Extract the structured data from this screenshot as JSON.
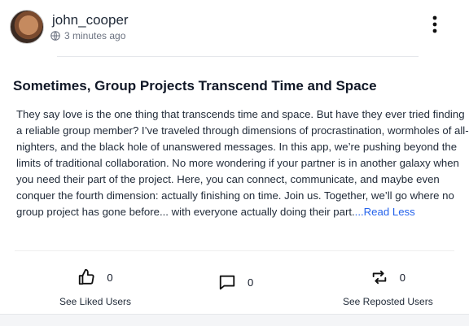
{
  "post": {
    "username": "john_cooper",
    "timestamp": "3 minutes ago",
    "title": "Sometimes, Group Projects Transcend Time and Space",
    "body": "They say love is the one thing that transcends time and space. But have they ever tried finding a reliable group member? I’ve traveled through dimensions of procrastination, wormholes of all-nighters, and the black hole of unanswered messages. In this app, we’re pushing beyond the limits of traditional collaboration. No more wondering if your partner is in another galaxy when you need their part of the project. Here, you can connect, communicate, and maybe even conquer the fourth dimension: actually finishing on time. Join us. Together, we’ll go where no group project has gone before... with everyone actually doing their part.",
    "read_less": "...Read Less"
  },
  "actions": {
    "like": {
      "count": "0",
      "label": "See Liked Users",
      "icon": "thumbs-up-icon"
    },
    "comment": {
      "count": "0",
      "icon": "comment-icon"
    },
    "repost": {
      "count": "0",
      "label": "See Reposted Users",
      "icon": "repost-icon"
    }
  },
  "colors": {
    "link": "#2563eb",
    "text": "#1f2937",
    "muted": "#6b7280"
  }
}
